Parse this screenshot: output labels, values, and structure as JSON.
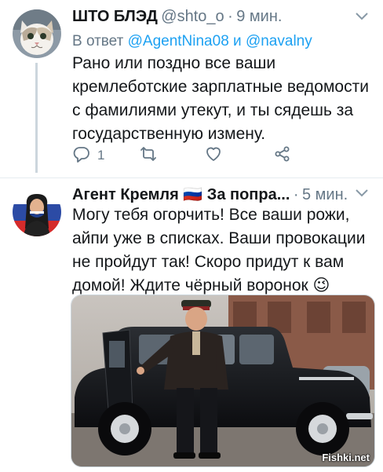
{
  "tweet1": {
    "name": "ШТО БЛЭД",
    "handle": "@shto_o",
    "separator": "·",
    "time": "9 мин.",
    "reply_prefix": "В ответ",
    "reply_user1": "@AgentNina08",
    "reply_and": "и",
    "reply_user2": "@navalny",
    "text": "Рано или поздно все ваши кремлеботские зарплатные ведомости с фамилиями утекут, и ты сядешь за государственную измену.",
    "reply_count": "1",
    "icons": {
      "reply": "reply-icon",
      "retweet": "retweet-icon",
      "like": "heart-icon",
      "share": "share-icon",
      "menu": "chevron-down-icon"
    }
  },
  "tweet2": {
    "name": "Агент Кремля 🇷🇺 За попра...",
    "separator": "·",
    "time": "5 мин.",
    "text": "Могу тебя огорчить! Все ваши рожи, айпи уже в списках. Ваши провокации не пройдут так! Скоро придут к вам домой! Ждите чёрный воронок 😉",
    "icons": {
      "menu": "chevron-down-icon"
    }
  },
  "watermark": "Fishki.net",
  "colors": {
    "link": "#1da1f2",
    "secondary": "#657786",
    "primary": "#14171a",
    "divider": "#e6ecf0"
  }
}
